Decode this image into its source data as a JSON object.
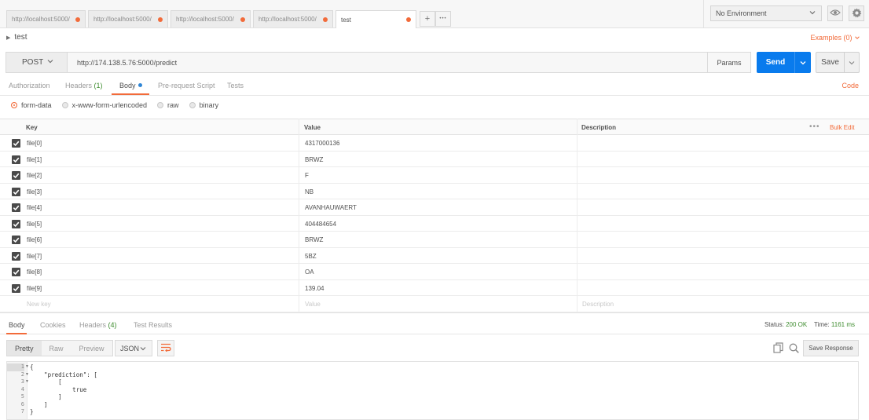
{
  "tabs": [
    {
      "label": "http://localhost:5000/"
    },
    {
      "label": "http://localhost:5000/"
    },
    {
      "label": "http://localhost:5000/"
    },
    {
      "label": "http://localhost:5000/"
    },
    {
      "label": "test"
    }
  ],
  "tab_actions": {
    "add_label": "+",
    "more_label": "•••"
  },
  "environment": {
    "selected": "No Environment"
  },
  "request": {
    "name": "test",
    "examples_label": "Examples (0)",
    "method": "POST",
    "url": "http://174.138.5.76:5000/predict",
    "params_label": "Params",
    "send_label": "Send",
    "save_label": "Save"
  },
  "request_tabs": {
    "authorization": "Authorization",
    "headers": "Headers",
    "headers_count": "(1)",
    "body": "Body",
    "pre_request": "Pre-request Script",
    "tests": "Tests",
    "code_link": "Code"
  },
  "body_types": {
    "form_data": "form-data",
    "urlencoded": "x-www-form-urlencoded",
    "raw": "raw",
    "binary": "binary",
    "selected": "form-data"
  },
  "kv_table": {
    "headers": {
      "key": "Key",
      "value": "Value",
      "description": "Description",
      "bulk_edit": "Bulk Edit"
    },
    "rows": [
      {
        "key": "file[0]",
        "value": "4317000136",
        "checked": true
      },
      {
        "key": "file[1]",
        "value": "BRWZ",
        "checked": true
      },
      {
        "key": "file[2]",
        "value": "F",
        "checked": true
      },
      {
        "key": "file[3]",
        "value": "NB",
        "checked": true
      },
      {
        "key": "file[4]",
        "value": "AVANHAUWAERT",
        "checked": true
      },
      {
        "key": "file[5]",
        "value": "404484654",
        "checked": true
      },
      {
        "key": "file[6]",
        "value": "BRWZ",
        "checked": true
      },
      {
        "key": "file[7]",
        "value": "5BZ",
        "checked": true
      },
      {
        "key": "file[8]",
        "value": "OA",
        "checked": true
      },
      {
        "key": "file[9]",
        "value": "139.04",
        "checked": true
      }
    ],
    "placeholders": {
      "key": "New key",
      "value": "Value",
      "description": "Description"
    }
  },
  "response": {
    "tabs": {
      "body": "Body",
      "cookies": "Cookies",
      "headers": "Headers",
      "headers_count": "(4)",
      "test_results": "Test Results"
    },
    "status_label": "Status:",
    "status_value": "200 OK",
    "time_label": "Time:",
    "time_value": "1161 ms",
    "formats": {
      "pretty": "Pretty",
      "raw": "Raw",
      "preview": "Preview"
    },
    "language": "JSON",
    "save_response_label": "Save Response",
    "lines": [
      {
        "num": "1",
        "text": "{"
      },
      {
        "num": "2",
        "text": "    \"prediction\": ["
      },
      {
        "num": "3",
        "text": "        ["
      },
      {
        "num": "4",
        "text": "            true"
      },
      {
        "num": "5",
        "text": "        ]"
      },
      {
        "num": "6",
        "text": "    ]"
      },
      {
        "num": "7",
        "text": "}"
      }
    ]
  },
  "colors": {
    "accent": "#f26b3a",
    "send": "#097bed",
    "ok": "#3d8c2e"
  }
}
